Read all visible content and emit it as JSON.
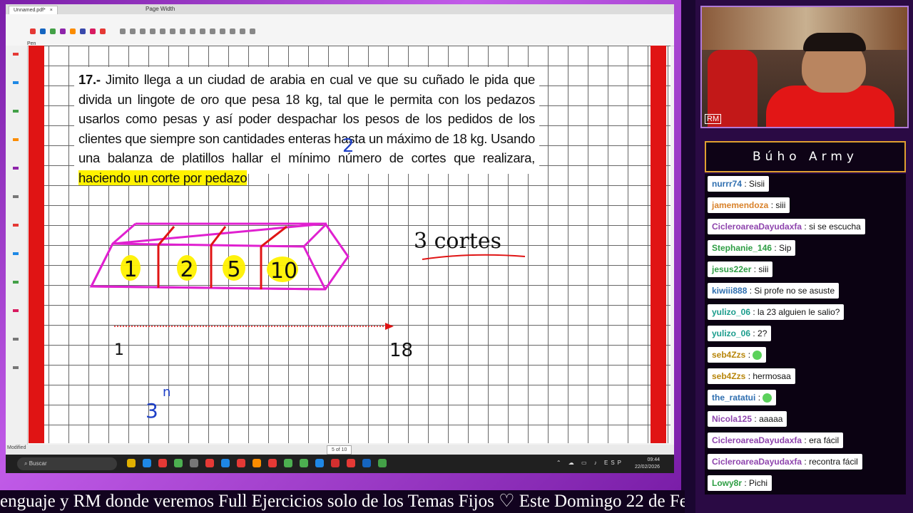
{
  "pdf_app": {
    "tab_title": "Unnamed.pdf*",
    "tab_close": "×",
    "zoom_mode": "Page Width",
    "tool_label": "Pen",
    "toolbar_colors": [
      "#e53935",
      "#1565c0",
      "#43a047",
      "#8e24aa",
      "#fb8c00",
      "#3949ab",
      "#d81b60",
      "#e53935"
    ],
    "status_left": "Modified",
    "pager": "5 of 10"
  },
  "problem": {
    "number": "17.-",
    "text": " Jimito llega a un ciudad de arabia en cual ve que su cuñado le pida que divida un lingote de oro que pesa 18 kg, tal que le permita con los pedazos usarlos como pesas y así poder despachar los pesos de los pedidos de los clientes que siempre son cantidades enteras hasta un máximo de 18 kg. Usando una balanza de platillos hallar el mínimo número de cortes que realizara, ",
    "highlight": "haciendo un corte por pedazo"
  },
  "annotations": {
    "blue_two": "2",
    "segments": [
      "1",
      "2",
      "5",
      "10"
    ],
    "cortes": "3 cortes",
    "axis_start": "1",
    "axis_end": "18",
    "power_base": "3",
    "power_exp": "n"
  },
  "taskbar": {
    "search_placeholder": "Buscar",
    "lang": "ESP",
    "time": "09:44",
    "date": "22/02/2026"
  },
  "webcam": {
    "watermark": "RM"
  },
  "chat": {
    "title": "Búho Army",
    "messages": [
      {
        "user": "nurrr74",
        "text": "Sisii",
        "color": "#2f6fb0"
      },
      {
        "user": "jamemendoza",
        "text": "siii",
        "color": "#d9822b"
      },
      {
        "user": "CicleroareaDayudaxfa",
        "text": "si se escucha",
        "color": "#8e44ad"
      },
      {
        "user": "Stephanie_146",
        "text": "Sip",
        "color": "#2e9e44"
      },
      {
        "user": "jesus22er",
        "text": "siii",
        "color": "#2e9e44"
      },
      {
        "user": "kiwiii888",
        "text": "Si profe no se asuste",
        "color": "#2f6fb0"
      },
      {
        "user": "yulizo_06",
        "text": "la 23 alguien le salio?",
        "color": "#1a9c8c"
      },
      {
        "user": "yulizo_06",
        "text": "2?",
        "color": "#1a9c8c"
      },
      {
        "user": "seb4Zzs",
        "text": "",
        "color": "#b8860b"
      },
      {
        "user": "seb4Zzs",
        "text": "hermosaa",
        "color": "#b8860b"
      },
      {
        "user": "the_ratatui",
        "text": "",
        "color": "#2f6fb0"
      },
      {
        "user": "Nicola125",
        "text": "aaaaa",
        "color": "#8e44ad"
      },
      {
        "user": "CicleroareaDayudaxfa",
        "text": "era fácil",
        "color": "#8e44ad"
      },
      {
        "user": "CicleroareaDayudaxfa",
        "text": "recontra fácil",
        "color": "#8e44ad"
      },
      {
        "user": "Lowy8r",
        "text": "Pichi",
        "color": "#2e9e44"
      }
    ]
  },
  "ticker": "enguaje y RM donde veremos Full Ejercicios solo de los Temas Fijos ♡     Este Domingo 22 de Fe"
}
